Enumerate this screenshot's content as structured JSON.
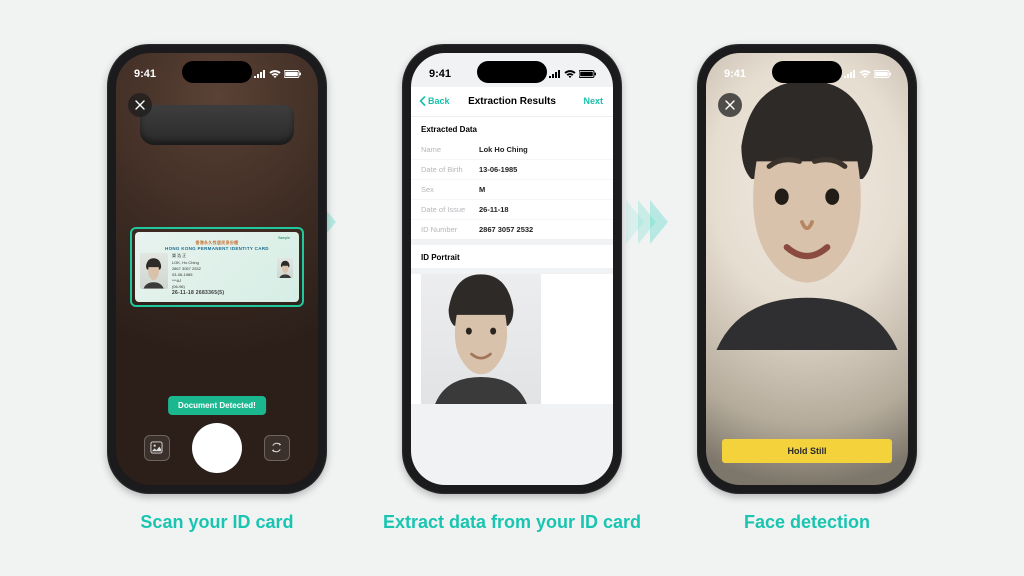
{
  "statusbar": {
    "time": "9:41"
  },
  "captions": {
    "scan": "Scan your ID card",
    "extract": "Extract data from your ID card",
    "face": "Face detection"
  },
  "scanner": {
    "detected_banner": "Document Detected!",
    "id_header_zh": "香港永久性居民身份證",
    "id_header_en": "HONG KONG PERMANENT IDENTITY CARD",
    "name_zh": "樂 浩 正",
    "name_en": "LOK, Ho Ching",
    "number_line": "2867 3057 2532",
    "dob_line": "03-06-1985",
    "stars": "***AJ",
    "issue": "(06-96)",
    "bottom": "26-11-18    2683365(5)"
  },
  "extract": {
    "nav_back": "Back",
    "nav_title": "Extraction Results",
    "nav_next": "Next",
    "section1": "Extracted Data",
    "fields": [
      {
        "label": "Name",
        "value": "Lok Ho Ching"
      },
      {
        "label": "Date of Birth",
        "value": "13-06-1985"
      },
      {
        "label": "Sex",
        "value": "M"
      },
      {
        "label": "Date of Issue",
        "value": "26-11-18"
      },
      {
        "label": "ID Number",
        "value": "2867 3057 2532"
      }
    ],
    "section2": "ID Portrait"
  },
  "face": {
    "hold_still": "Hold Still"
  },
  "colors": {
    "accent": "#19c5b0",
    "banner": "#1bb890",
    "hold_still_bg": "#f3d23b"
  }
}
